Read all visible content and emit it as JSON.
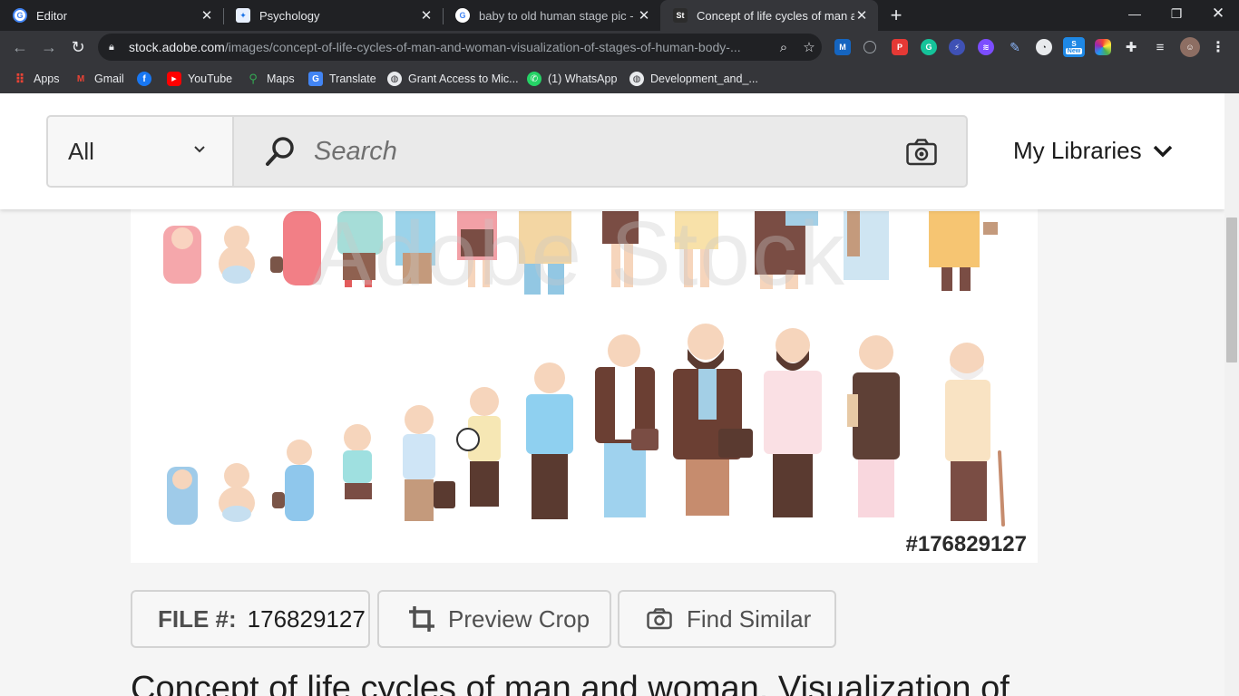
{
  "browser": {
    "tabs": [
      {
        "title": "Editor",
        "active": false
      },
      {
        "title": "Psychology",
        "active": false
      },
      {
        "title": "baby to old human stage pic - Go",
        "active": false
      },
      {
        "title": "Concept of life cycles of man and",
        "active": true
      }
    ],
    "url_domain": "stock.adobe.com",
    "url_path": "/images/concept-of-life-cycles-of-man-and-woman-visualization-of-stages-of-human-body-...",
    "bookmarks": [
      "Apps",
      "Gmail",
      "YouTube",
      "Maps",
      "Translate",
      "Grant Access to Mic...",
      "(1) WhatsApp",
      "Development_and_..."
    ],
    "ext_new_badge": "New"
  },
  "header": {
    "filter_value": "All",
    "search_placeholder": "Search",
    "my_libraries": "My Libraries"
  },
  "image": {
    "watermark": "Adobe Stock",
    "file_tag": "#176829127"
  },
  "actions": {
    "file_label": "FILE #:",
    "file_number": "176829127",
    "preview_crop": "Preview Crop",
    "find_similar": "Find Similar"
  },
  "asset_title": "Concept of life cycles of man and woman. Visualization of",
  "colors": {
    "chrome_dark": "#202124",
    "chrome_toolbar": "#35363a",
    "page_bg": "#f5f5f5",
    "search_bg": "#eaeaea"
  }
}
